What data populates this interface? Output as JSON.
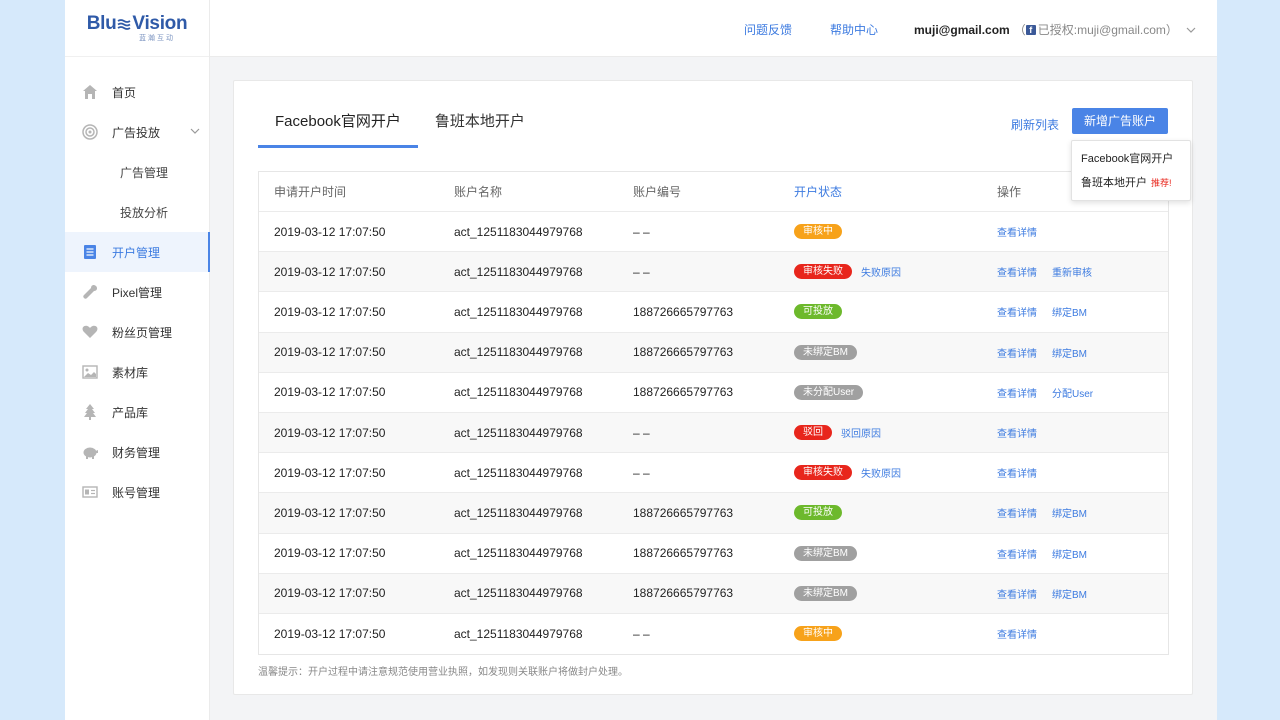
{
  "brand": {
    "name_left": "Blu",
    "name_right": "Vision",
    "subtitle": "蓝瀚互动"
  },
  "sidebar": {
    "items": [
      {
        "label": "首页",
        "icon": "home-icon"
      },
      {
        "label": "广告投放",
        "icon": "target-icon",
        "expandable": true
      },
      {
        "label": "广告管理",
        "sub": true
      },
      {
        "label": "投放分析",
        "sub": true
      },
      {
        "label": "开户管理",
        "icon": "document-icon",
        "active": true
      },
      {
        "label": "Pixel管理",
        "icon": "wrench-icon"
      },
      {
        "label": "粉丝页管理",
        "icon": "heart-icon"
      },
      {
        "label": "素材库",
        "icon": "image-icon"
      },
      {
        "label": "产品库",
        "icon": "tree-icon"
      },
      {
        "label": "财务管理",
        "icon": "piggy-bank-icon"
      },
      {
        "label": "账号管理",
        "icon": "id-card-icon"
      }
    ]
  },
  "header": {
    "feedback": "问题反馈",
    "help": "帮助中心",
    "user_email": "muji@gmail.com",
    "auth_open": "（",
    "auth_text": "已授权:muji@gmail.com）"
  },
  "tabs": [
    {
      "label": "Facebook官网开户",
      "active": true
    },
    {
      "label": "鲁班本地开户",
      "active": false
    }
  ],
  "actions": {
    "refresh": "刷新列表",
    "add_account": "新增广告账户"
  },
  "dropdown": {
    "item1": "Facebook官网开户",
    "item2": "鲁班本地开户",
    "item2_badge": "推荐!"
  },
  "table": {
    "headers": [
      "申请开户时间",
      "账户名称",
      "账户编号",
      "开户状态",
      "操作"
    ],
    "rows": [
      {
        "time": "2019-03-12 17:07:50",
        "name": "act_1251183044979768",
        "id": "– –",
        "status": "审核中",
        "color": "orange",
        "reason": "",
        "ops": [
          "查看详情"
        ]
      },
      {
        "time": "2019-03-12 17:07:50",
        "name": "act_1251183044979768",
        "id": "– –",
        "status": "审核失败",
        "color": "red",
        "reason": "失败原因",
        "ops": [
          "查看详情",
          "重新审核"
        ]
      },
      {
        "time": "2019-03-12 17:07:50",
        "name": "act_1251183044979768",
        "id": "188726665797763",
        "status": "可投放",
        "color": "green",
        "reason": "",
        "ops": [
          "查看详情",
          "绑定BM"
        ]
      },
      {
        "time": "2019-03-12 17:07:50",
        "name": "act_1251183044979768",
        "id": "188726665797763",
        "status": "未绑定BM",
        "color": "gray",
        "reason": "",
        "ops": [
          "查看详情",
          "绑定BM"
        ]
      },
      {
        "time": "2019-03-12 17:07:50",
        "name": "act_1251183044979768",
        "id": "188726665797763",
        "status": "未分配User",
        "color": "gray",
        "reason": "",
        "ops": [
          "查看详情",
          "分配User"
        ]
      },
      {
        "time": "2019-03-12 17:07:50",
        "name": "act_1251183044979768",
        "id": "– –",
        "status": "驳回",
        "color": "red",
        "reason": "驳回原因",
        "ops": [
          "查看详情"
        ]
      },
      {
        "time": "2019-03-12 17:07:50",
        "name": "act_1251183044979768",
        "id": "– –",
        "status": "审核失败",
        "color": "red",
        "reason": "失败原因",
        "ops": [
          "查看详情"
        ]
      },
      {
        "time": "2019-03-12 17:07:50",
        "name": "act_1251183044979768",
        "id": "188726665797763",
        "status": "可投放",
        "color": "green",
        "reason": "",
        "ops": [
          "查看详情",
          "绑定BM"
        ]
      },
      {
        "time": "2019-03-12 17:07:50",
        "name": "act_1251183044979768",
        "id": "188726665797763",
        "status": "未绑定BM",
        "color": "gray",
        "reason": "",
        "ops": [
          "查看详情",
          "绑定BM"
        ]
      },
      {
        "time": "2019-03-12 17:07:50",
        "name": "act_1251183044979768",
        "id": "188726665797763",
        "status": "未绑定BM",
        "color": "gray",
        "reason": "",
        "ops": [
          "查看详情",
          "绑定BM"
        ]
      },
      {
        "time": "2019-03-12 17:07:50",
        "name": "act_1251183044979768",
        "id": "– –",
        "status": "审核中",
        "color": "orange",
        "reason": "",
        "ops": [
          "查看详情"
        ]
      }
    ]
  },
  "footer_tip": "温馨提示：开户过程中请注意规范使用营业执照，如发现则关联账户将做封户处理。",
  "colors": {
    "accent": "#4a84e6",
    "link": "#3d7be0",
    "orange": "#f7a21a",
    "red": "#e8261c",
    "green": "#6db92c",
    "gray": "#a0a0a0"
  }
}
